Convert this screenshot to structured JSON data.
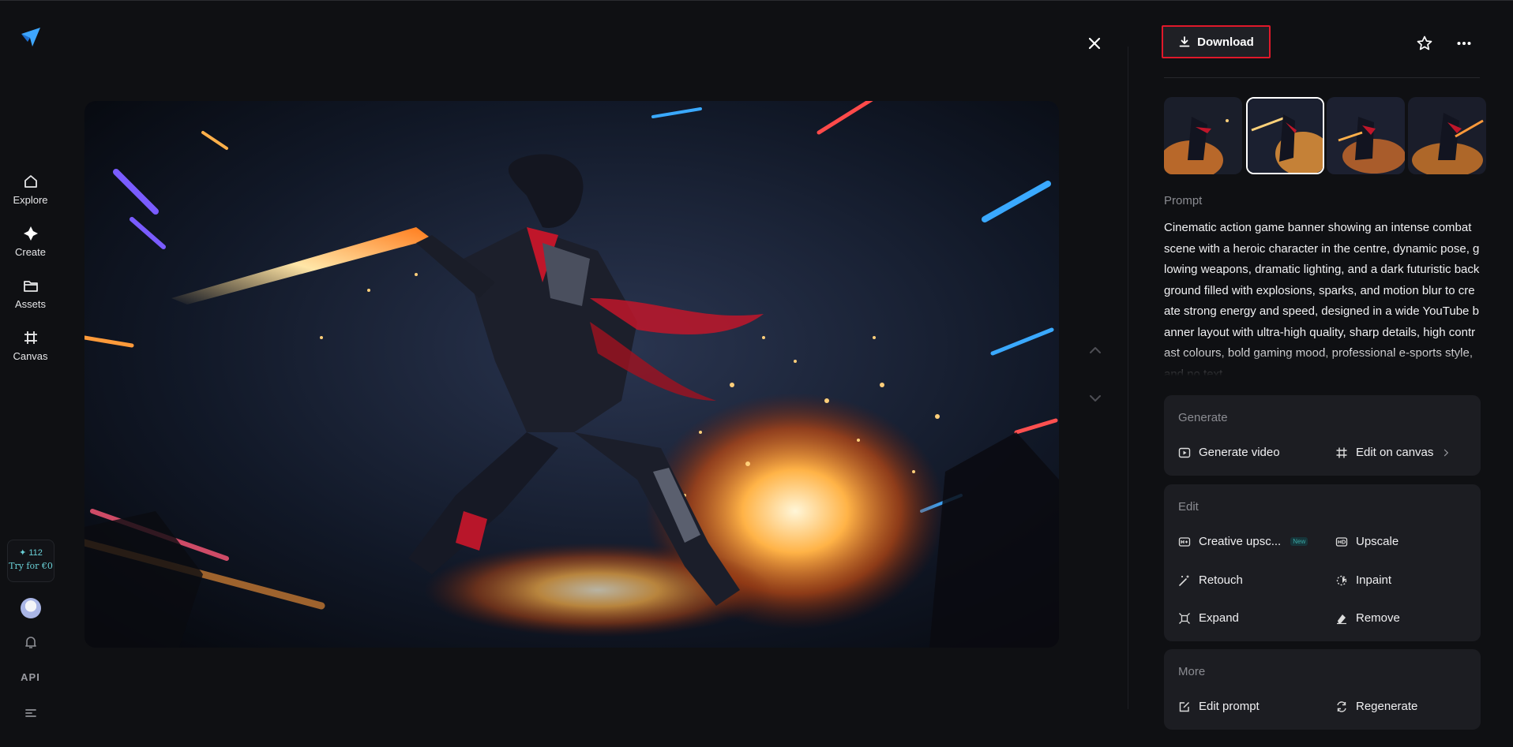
{
  "nav": {
    "items": [
      {
        "label": "Explore",
        "icon": "home-icon"
      },
      {
        "label": "Create",
        "icon": "sparkle-icon"
      },
      {
        "label": "Assets",
        "icon": "folder-icon"
      },
      {
        "label": "Canvas",
        "icon": "canvas-icon"
      }
    ],
    "credits": {
      "count": "✦ 112",
      "cta": "Try for €0"
    },
    "api_label": "API"
  },
  "toolbar": {
    "download_label": "Download"
  },
  "prompt": {
    "label": "Prompt",
    "text": "Cinematic action game banner showing an intense combat scene with a heroic character in the centre, dynamic pose, glowing weapons, dramatic lighting, and a dark futuristic background filled with explosions, sparks, and motion blur to create strong energy and speed, designed in a wide YouTube banner layout with ultra-high quality, sharp details, high contrast colours, bold gaming mood, professional e-sports style, and no text"
  },
  "generate": {
    "title": "Generate",
    "video": "Generate video",
    "canvas": "Edit on canvas"
  },
  "edit": {
    "title": "Edit",
    "creative_upscale": "Creative upsc...",
    "new_badge": "New",
    "upscale": "Upscale",
    "retouch": "Retouch",
    "inpaint": "Inpaint",
    "expand": "Expand",
    "remove": "Remove"
  },
  "more": {
    "title": "More",
    "edit_prompt": "Edit prompt",
    "regenerate": "Regenerate"
  },
  "colors": {
    "accent_red": "#e0182a",
    "logo_blue": "#3ea6ff",
    "credits_teal": "#6ad0d6"
  }
}
